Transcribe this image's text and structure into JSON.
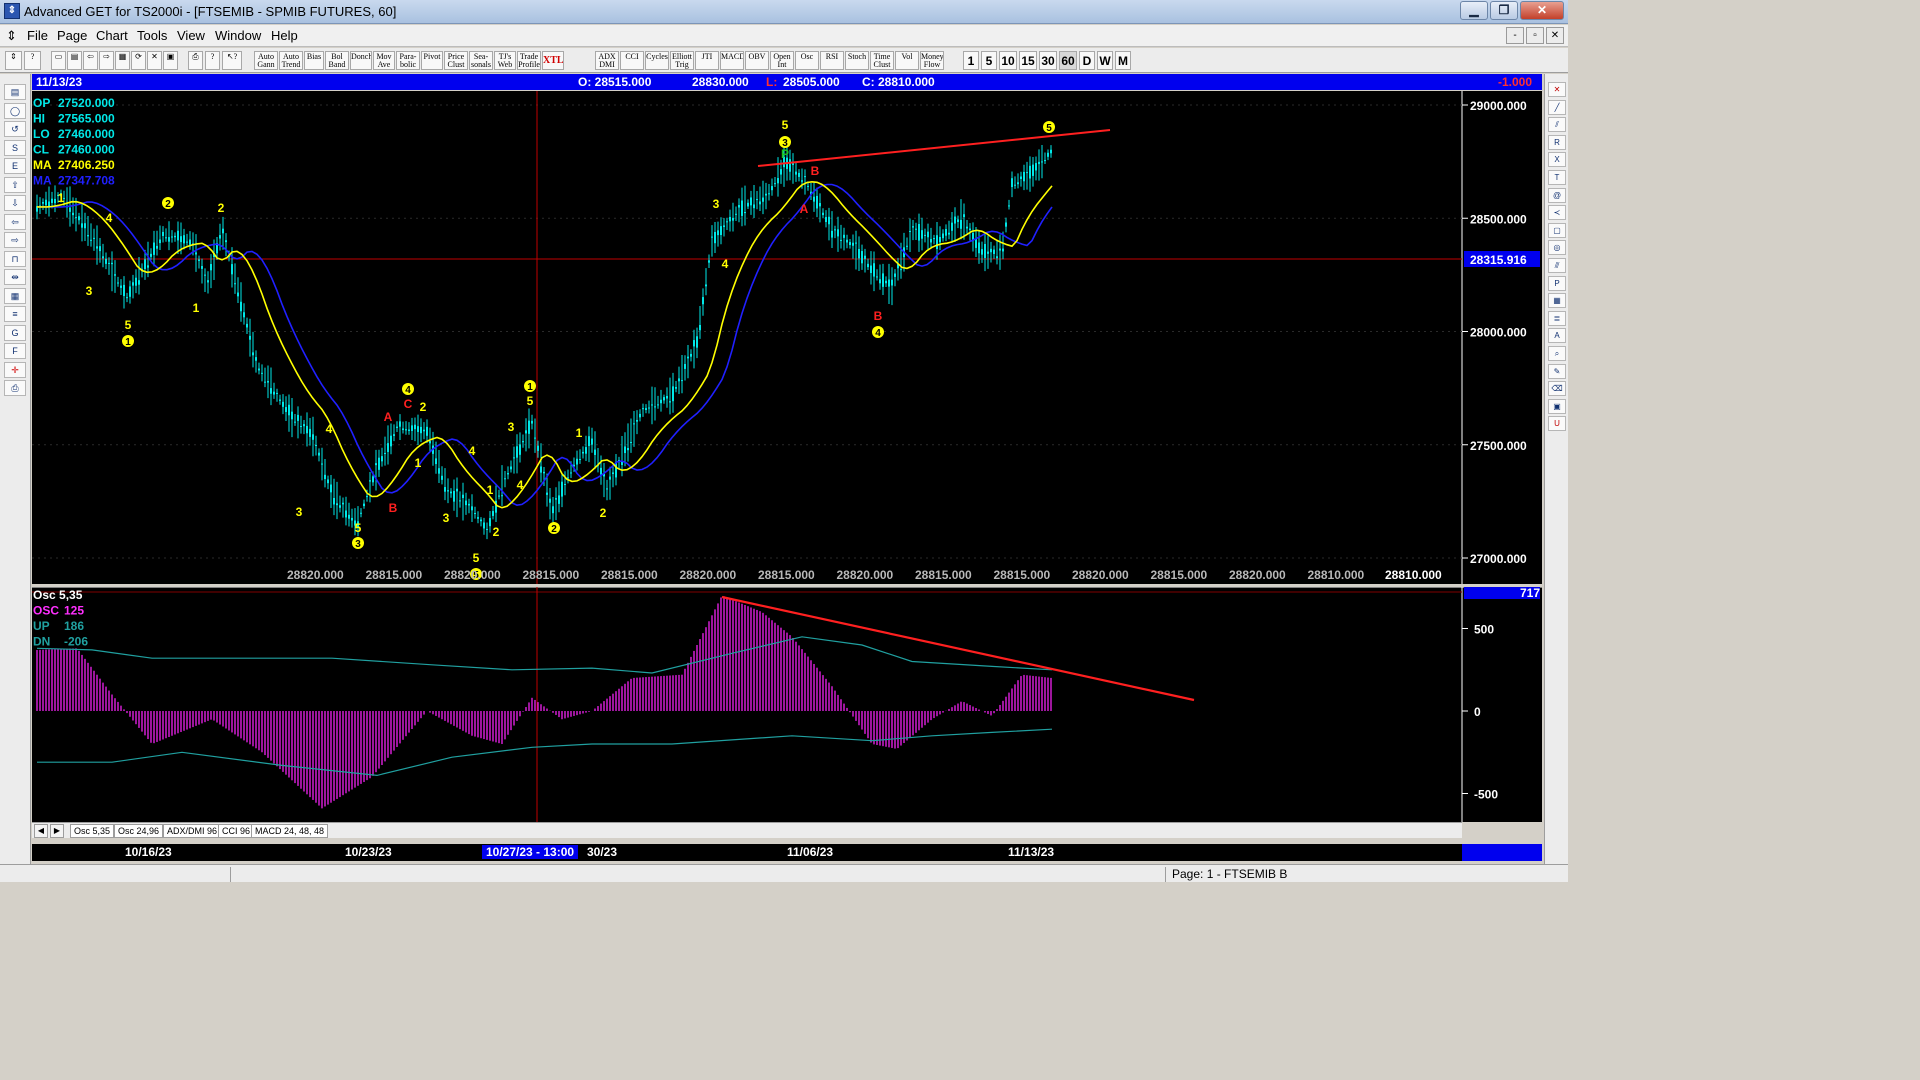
{
  "window": {
    "title": "Advanced GET for TS2000i - [FTSEMIB - SPMIB FUTURES, 60]",
    "buttons": [
      "▁",
      "❐",
      "✕"
    ],
    "mdi_buttons": [
      "-",
      "▫",
      "✕"
    ]
  },
  "menu": [
    "File",
    "Page",
    "Chart",
    "Tools",
    "View",
    "Window",
    "Help"
  ],
  "toolbar": {
    "studies": [
      "Auto Gann",
      "Auto Trend",
      "Bias",
      "Bol Band",
      "Donch",
      "Mov Ave",
      "Para-bolic",
      "Pivot",
      "Price Clust",
      "Sea-sonals",
      "TJ's Web",
      "Trade Profile",
      "XTL",
      "ADX DMI",
      "CCI",
      "Cycles",
      "Elliott Trig",
      "JTI",
      "MACD",
      "OBV",
      "Open Int",
      "Osc",
      "RSI",
      "Stoch",
      "Time Clust",
      "Vol",
      "Money Flow"
    ],
    "timeframes": [
      "1",
      "5",
      "10",
      "15",
      "30",
      "60",
      "D",
      "W",
      "M"
    ]
  },
  "infobar": {
    "date": "11/13/23",
    "open": "O: 28515.000",
    "high": "28830.000",
    "low_label": "L:",
    "low": "28505.000",
    "close": "C: 28810.000",
    "change": "-1.000"
  },
  "price_panel": {
    "values": [
      {
        "label": "OP",
        "value": "27520.000",
        "color": "#00e8e8"
      },
      {
        "label": "HI",
        "value": "27565.000",
        "color": "#00e8e8"
      },
      {
        "label": "LO",
        "value": "27460.000",
        "color": "#00e8e8"
      },
      {
        "label": "CL",
        "value": "27460.000",
        "color": "#00e8e8"
      },
      {
        "label": "MA",
        "value": "27406.250",
        "color": "#ffff00"
      },
      {
        "label": "MA",
        "value": "27347.708",
        "color": "#2020ff"
      }
    ],
    "y_ticks": [
      "29000.000",
      "28500.000",
      "28000.000",
      "27500.000",
      "27000.000"
    ],
    "crosshair_price": "28315.916",
    "bottom_strip": [
      "28820.000",
      "28815.000",
      "28820.000",
      "28815.000",
      "28815.000",
      "28820.000",
      "28815.000",
      "28820.000",
      "28815.000",
      "28815.000",
      "28820.000",
      "28815.000",
      "28820.000",
      "28810.000"
    ],
    "bottom_strip_last": "28810.000",
    "wave_labels": [
      {
        "t": "1",
        "c": "#ffff00",
        "circ": false
      },
      {
        "t": "3",
        "c": "#ffff00",
        "circ": false
      },
      {
        "t": "4",
        "c": "#ffff00",
        "circ": false
      },
      {
        "t": "5",
        "c": "#ffff00",
        "circ": false
      },
      {
        "t": "1",
        "c": "#ffff00",
        "circ": true
      },
      {
        "t": "2",
        "c": "#ffff00",
        "circ": true
      },
      {
        "t": "1",
        "c": "#ffff00",
        "circ": false
      },
      {
        "t": "2",
        "c": "#ffff00",
        "circ": false
      },
      {
        "t": "3",
        "c": "#ffff00",
        "circ": false
      },
      {
        "t": "4",
        "c": "#ffff00",
        "circ": false
      },
      {
        "t": "5",
        "c": "#ffff00",
        "circ": false
      },
      {
        "t": "3",
        "c": "#ffff00",
        "circ": true
      },
      {
        "t": "A",
        "c": "#ff2020",
        "circ": false
      },
      {
        "t": "B",
        "c": "#ff2020",
        "circ": false
      },
      {
        "t": "C",
        "c": "#ff2020",
        "circ": false
      },
      {
        "t": "4",
        "c": "#ffff00",
        "circ": true
      },
      {
        "t": "2",
        "c": "#ffff00",
        "circ": false
      },
      {
        "t": "1",
        "c": "#ffff00",
        "circ": false
      },
      {
        "t": "3",
        "c": "#ffff00",
        "circ": false
      },
      {
        "t": "4",
        "c": "#ffff00",
        "circ": false
      },
      {
        "t": "1",
        "c": "#ffff00",
        "circ": false
      },
      {
        "t": "2",
        "c": "#ffff00",
        "circ": false
      },
      {
        "t": "5",
        "c": "#ffff00",
        "circ": false
      },
      {
        "t": "3",
        "c": "#ffff00",
        "circ": false
      },
      {
        "t": "4",
        "c": "#ffff00",
        "circ": false
      },
      {
        "t": "5",
        "c": "#ffff00",
        "circ": false
      },
      {
        "t": "1",
        "c": "#ffff00",
        "circ": true
      },
      {
        "t": "2",
        "c": "#ffff00",
        "circ": true
      },
      {
        "t": "1",
        "c": "#ffff00",
        "circ": false
      },
      {
        "t": "2",
        "c": "#ffff00",
        "circ": false
      },
      {
        "t": "3",
        "c": "#ffff00",
        "circ": false
      },
      {
        "t": "4",
        "c": "#ffff00",
        "circ": false
      },
      {
        "t": "3",
        "c": "#ffff00",
        "circ": true
      },
      {
        "t": "5",
        "c": "#ffff00",
        "circ": false
      },
      {
        "t": "P",
        "c": "#20c020",
        "circ": false
      },
      {
        "t": "A",
        "c": "#ff2020",
        "circ": false
      },
      {
        "t": "B",
        "c": "#ff2020",
        "circ": false
      },
      {
        "t": "B",
        "c": "#ff2020",
        "circ": false
      },
      {
        "t": "4",
        "c": "#ffff00",
        "circ": true
      },
      {
        "t": "5",
        "c": "#ffff00",
        "circ": true
      },
      {
        "t": "5",
        "c": "#ffff00",
        "circ": true
      }
    ]
  },
  "osc_panel": {
    "legend": [
      {
        "label": "Osc 5,35",
        "value": "",
        "color": "#ffffff"
      },
      {
        "label": "OSC",
        "value": "125",
        "color": "#ff30ff"
      },
      {
        "label": "UP",
        "value": "186",
        "color": "#20a0a0"
      },
      {
        "label": "DN",
        "value": "-206",
        "color": "#20a0a0"
      }
    ],
    "current_value": "717",
    "y_ticks": [
      "500",
      "0",
      "-500"
    ]
  },
  "tabs": [
    "Osc 5,35",
    "Osc 24,96",
    "ADX/DMI 96",
    "CCI 96",
    "MACD 24, 48, 48"
  ],
  "tab_nav": [
    "◀",
    "▶"
  ],
  "date_axis": {
    "labels": [
      "10/16/23",
      "10/23/23",
      "30/23",
      "11/06/23",
      "11/13/23"
    ],
    "cursor_date": "10/27/23 - 13:00"
  },
  "statusbar": {
    "page": "Page: 1 - FTSEMIB B"
  },
  "colors": {
    "chart_bg": "#000000",
    "price_bars": "#00e8e8",
    "ma_fast": "#ffff00",
    "ma_slow": "#2020ff",
    "trendline": "#ff2020",
    "crosshair": "#c00000",
    "osc_histogram": "#e020e0",
    "osc_bands": "#20a0a0",
    "info_bar": "#0000ee"
  },
  "icons": {
    "left_tools": [
      "open-folder-icon",
      "ellipse-tool-icon",
      "reset-icon",
      "study-icon",
      "elliott-icon",
      "arrow-up-icon",
      "arrow-down-icon",
      "arrow-left-icon",
      "arrow-right-icon",
      "bracket-icon",
      "fib-range-icon",
      "grid-icon",
      "lines-icon",
      "gann-icon",
      "fib-icon",
      "crosshair-icon",
      "print-icon"
    ],
    "right_tools": [
      "cross-close-icon",
      "diagonal-line-icon",
      "parallel-lines-icon",
      "fib-ret-icon",
      "fib-ext-icon",
      "fib-time-icon",
      "spiral-icon",
      "fan-icon",
      "box-icon",
      "ellipse-icon",
      "channel-icon",
      "pti-icon",
      "grid-icon",
      "prob-icon",
      "text-icon",
      "zoom-icon",
      "pencil-icon",
      "erase-icon",
      "clipboard-icon",
      "magnet-icon"
    ]
  }
}
